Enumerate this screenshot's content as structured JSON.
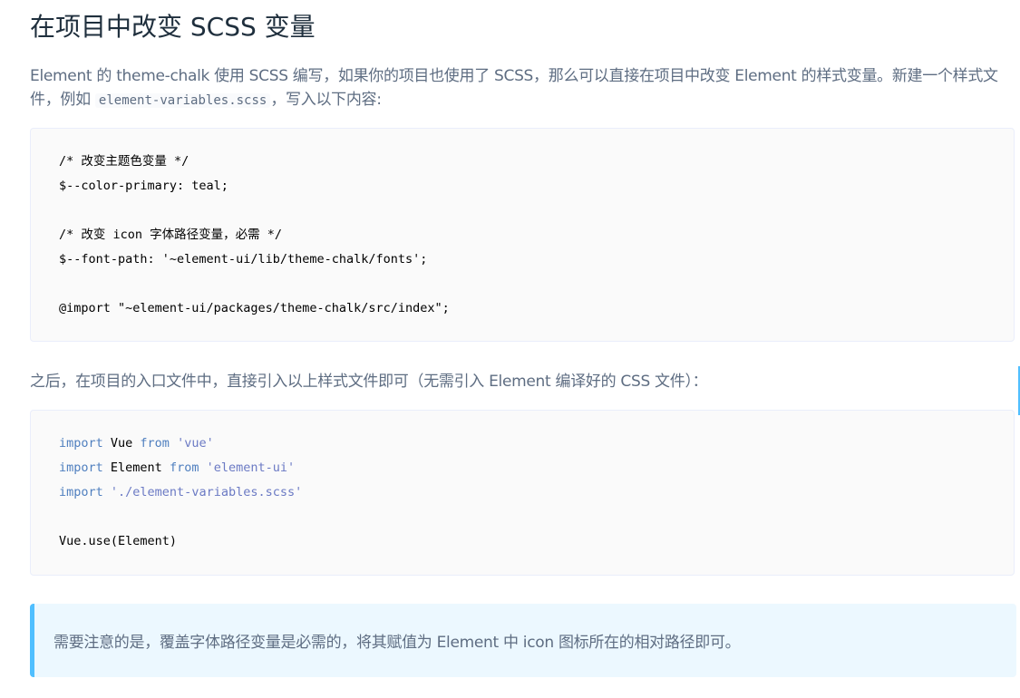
{
  "title": "在项目中改变 SCSS 变量",
  "intro": {
    "text_before": "Element 的 theme-chalk 使用 SCSS 编写，如果你的项目也使用了 SCSS，那么可以直接在项目中改变 Element 的样式变量。新建一个样式文件，例如 ",
    "code": "element-variables.scss",
    "text_after": "，写入以下内容:"
  },
  "code_block_1": {
    "lines": [
      "/* 改变主题色变量 */",
      "$--color-primary: teal;",
      "",
      "/* 改变 icon 字体路径变量，必需 */",
      "$--font-path: '~element-ui/lib/theme-chalk/fonts';",
      "",
      "@import \"~element-ui/packages/theme-chalk/src/index\";"
    ]
  },
  "after_para": "之后，在项目的入口文件中，直接引入以上样式文件即可（无需引入 Element 编译好的 CSS 文件）：",
  "code_block_2": {
    "line1": {
      "kw1": "import",
      "name": " Vue ",
      "kw2": "from",
      "str": " 'vue'"
    },
    "line2": {
      "kw1": "import",
      "name": " Element ",
      "kw2": "from",
      "str": " 'element-ui'"
    },
    "line3": {
      "kw1": "import",
      "str": " './element-variables.scss'"
    },
    "line5": "Vue.use(Element)"
  },
  "tip": "需要注意的是，覆盖字体路径变量是必需的，将其赋值为 Element 中 icon 图标所在的相对路径即可。",
  "colors": {
    "heading": "#1f2f3d",
    "body_text": "#5e6d82",
    "keyword": "#4f7fbf",
    "string": "#6b7ac4",
    "tip_background": "#ecf8ff",
    "tip_border": "#50bfff",
    "code_background": "#fafafa"
  }
}
